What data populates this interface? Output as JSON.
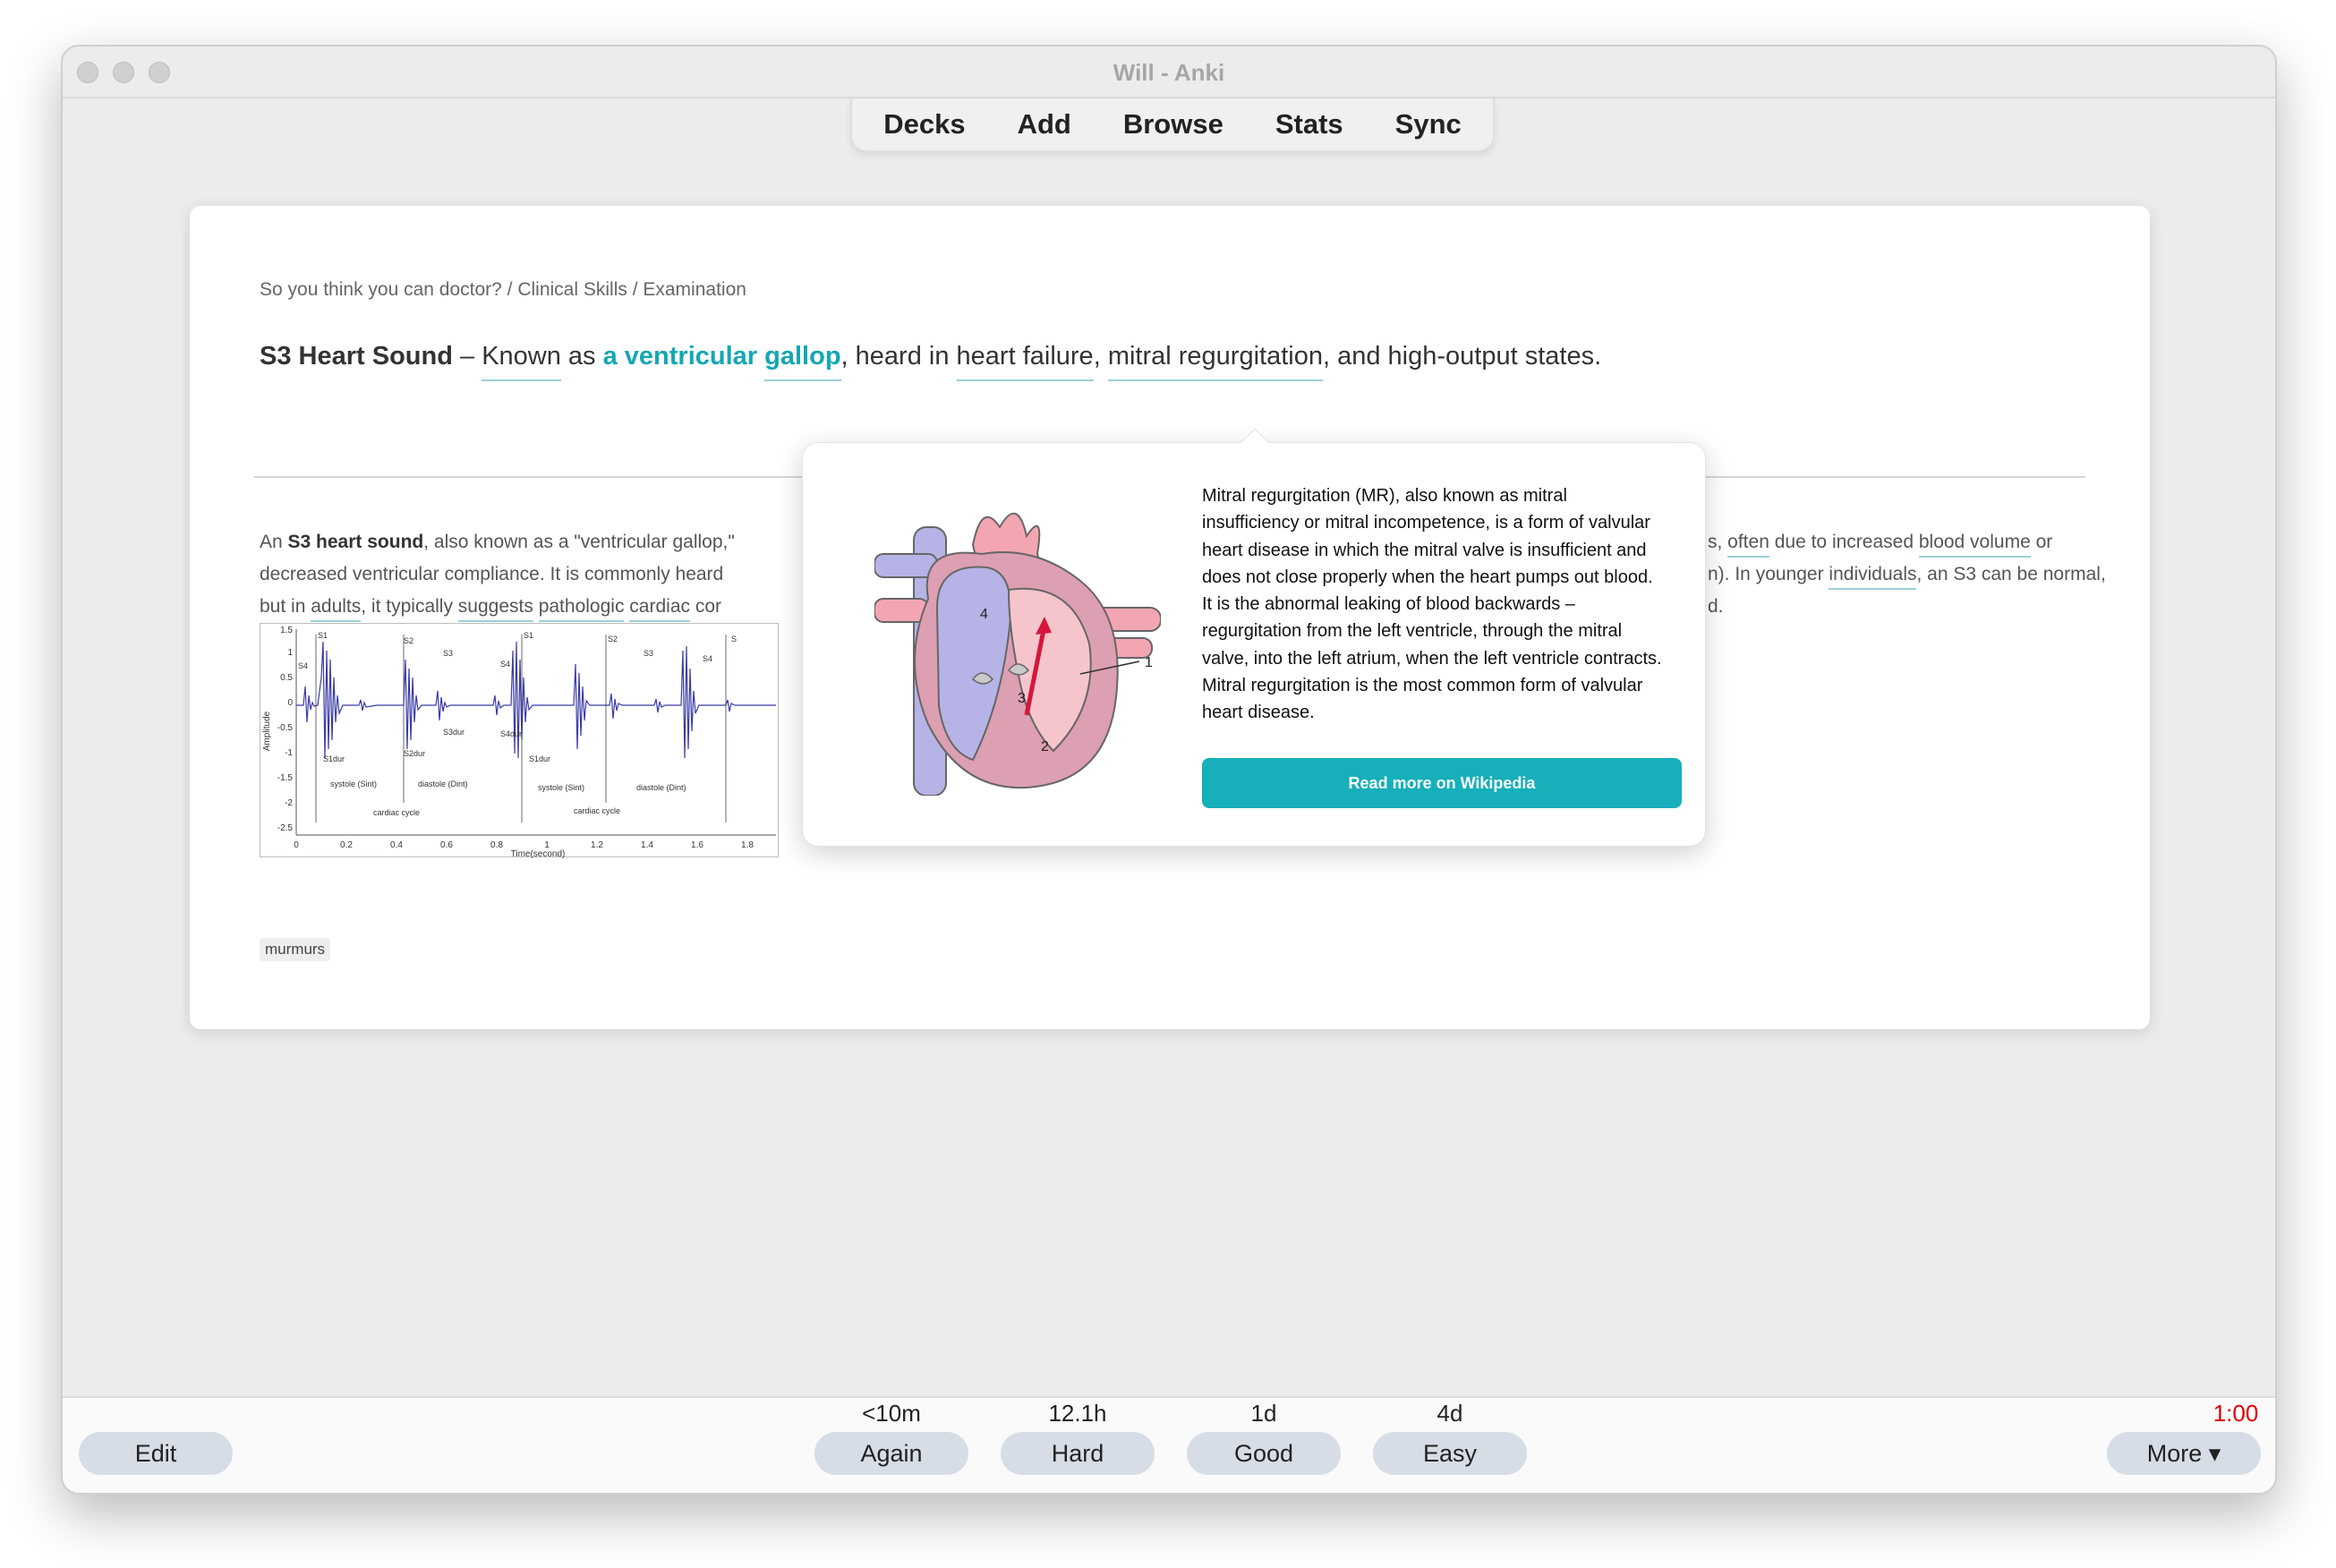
{
  "window": {
    "title": "Will - Anki"
  },
  "toolbar": {
    "items": [
      "Decks",
      "Add",
      "Browse",
      "Stats",
      "Sync"
    ]
  },
  "card": {
    "breadcrumb": "So you think you can doctor? / Clinical Skills / Examination",
    "front": {
      "term": "S3 Heart Sound",
      "dash": " – ",
      "known": "Known",
      "as": " as ",
      "gallop_a": "a ventricular",
      "gallop_b": "gallop",
      "heard_in": ", heard in ",
      "heart_failure": "heart failure",
      "comma": ", ",
      "mitral": "mitral regurgitation",
      "tail": ", and high-output states."
    },
    "back": {
      "line1_a": "An ",
      "line1_b": "S3 heart sound",
      "line1_c": ", also known as a \"ventricular gallop,\"",
      "line2": "decreased ventricular compliance. It is commonly heard",
      "line3_a": "but in ",
      "line3_b": "adults",
      "line3_c": ", it typically ",
      "line3_d": "suggests",
      "line3_e": "pathologic",
      "line3_f": "cardiac",
      "line3_g": " cor",
      "right1_a": "s, ",
      "right1_b": "often",
      "right1_c": " due to increased ",
      "right1_d": "blood volume",
      "right1_e": " or",
      "right2_a": "n). In younger ",
      "right2_b": "individuals",
      "right2_c": ", an S3 can be normal,",
      "right3": "d."
    },
    "figure": {
      "yticks": [
        "1.5",
        "1",
        "0.5",
        "0",
        "-0.5",
        "-1",
        "-1.5",
        "-2",
        "-2.5"
      ],
      "xticks": [
        "0",
        "0.2",
        "0.4",
        "0.6",
        "0.8",
        "1",
        "1.2",
        "1.4",
        "1.6",
        "1.8"
      ],
      "xlabel": "Time(second)",
      "ylabel": "Amplitude",
      "labels": [
        "S1",
        "S2",
        "S3",
        "S4",
        "S1",
        "S2",
        "S3",
        "S4",
        "S",
        "S4",
        "S1dur",
        "S2dur",
        "S3dur",
        "S4dur",
        "S1dur",
        "systole (Sint)",
        "diastole (Dint)",
        "systole (Sint)",
        "diastole (Dint)",
        "cardiac cycle",
        "cardiac cycle"
      ]
    },
    "tag": "murmurs"
  },
  "popup": {
    "text": "Mitral regurgitation (MR), also known as mitral insufficiency or mitral incompetence, is a form of valvular heart disease in which the mitral valve is insufficient and does not close properly when the heart pumps out blood. It is the abnormal leaking of blood backwards – regurgitation from the left ventricle, through the mitral valve, into the left atrium, when the left ventricle contracts. Mitral regurgitation is the most common form of valvular heart disease.",
    "button": "Read more on Wikipedia",
    "diagram_labels": [
      "1",
      "2",
      "3",
      "4"
    ]
  },
  "bottom": {
    "edit": "Edit",
    "answers": [
      {
        "due": "<10m",
        "label": "Again"
      },
      {
        "due": "12.1h",
        "label": "Hard"
      },
      {
        "due": "1d",
        "label": "Good"
      },
      {
        "due": "4d",
        "label": "Easy"
      }
    ],
    "timer": "1:00",
    "more": "More ▾"
  },
  "colors": {
    "accent": "#14a7b3",
    "button_bg": "#d7dde6",
    "timer": "#e00000"
  }
}
